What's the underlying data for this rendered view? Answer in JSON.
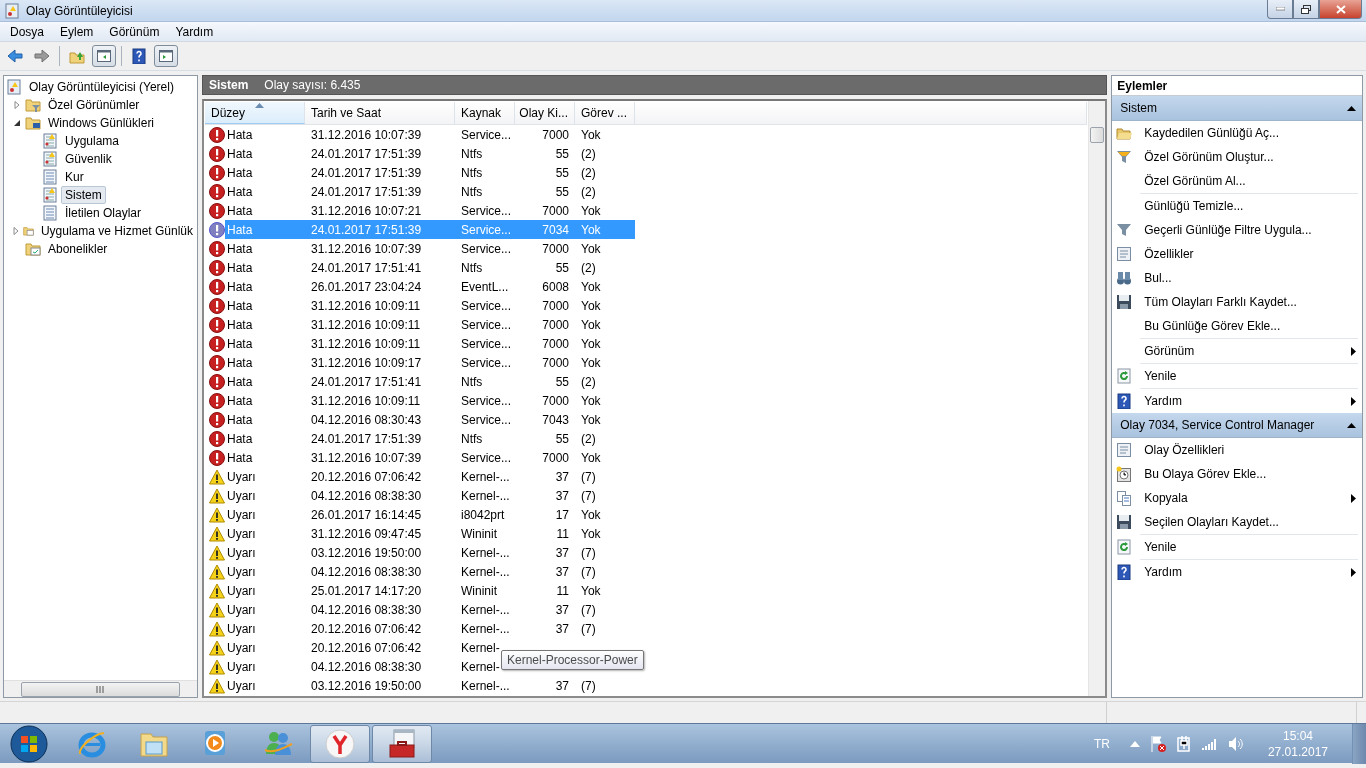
{
  "window": {
    "title": "Olay Görüntüleyicisi"
  },
  "menu": [
    "Dosya",
    "Eylem",
    "Görünüm",
    "Yardım"
  ],
  "toolbar": [
    {
      "kind": "back",
      "pressed": false
    },
    {
      "kind": "forward",
      "pressed": false
    },
    {
      "kind": "up",
      "pressed": false
    },
    {
      "kind": "tree-pane",
      "pressed": true
    },
    {
      "kind": "help",
      "pressed": false
    },
    {
      "kind": "action-pane",
      "pressed": true
    }
  ],
  "tree": [
    {
      "label": "Olay Görüntüleyicisi (Yerel)",
      "kind": "root",
      "selected": false
    },
    {
      "label": "Özel Görünümler",
      "kind": "filter-folder",
      "selected": false,
      "expanded": false
    },
    {
      "label": "Windows Günlükleri",
      "kind": "pc-folder",
      "selected": false,
      "expanded": true,
      "children": [
        {
          "label": "Uygulama",
          "kind": "log-alert",
          "selected": false
        },
        {
          "label": "Güvenlik",
          "kind": "log-alert",
          "selected": false
        },
        {
          "label": "Kur",
          "kind": "log",
          "selected": false
        },
        {
          "label": "Sistem",
          "kind": "log-alert",
          "selected": true
        },
        {
          "label": "İletilen Olaylar",
          "kind": "log",
          "selected": false
        }
      ]
    },
    {
      "label": "Uygulama ve Hizmet Günlük",
      "kind": "folder",
      "selected": false,
      "expanded": false
    },
    {
      "label": "Abonelikler",
      "kind": "sub-folder",
      "selected": false
    }
  ],
  "log_header": {
    "title": "Sistem",
    "count": "Olay sayısı: 6.435"
  },
  "table": {
    "columns": [
      {
        "label": "Düzey",
        "sorted": true
      },
      {
        "label": "Tarih ve Saat",
        "sorted": false
      },
      {
        "label": "Kaynak",
        "sorted": false
      },
      {
        "label": "Olay Ki...",
        "sorted": false
      },
      {
        "label": "Görev ...",
        "sorted": false
      }
    ],
    "rows": [
      {
        "kind": "error",
        "severity": "Hata",
        "date": "31.12.2016 10:07:39",
        "source": "Service...",
        "event_id": "7000",
        "task": "Yok",
        "selected": false
      },
      {
        "kind": "error",
        "severity": "Hata",
        "date": "24.01.2017 17:51:39",
        "source": "Ntfs",
        "event_id": "55",
        "task": "(2)",
        "selected": false
      },
      {
        "kind": "error",
        "severity": "Hata",
        "date": "24.01.2017 17:51:39",
        "source": "Ntfs",
        "event_id": "55",
        "task": "(2)",
        "selected": false
      },
      {
        "kind": "error",
        "severity": "Hata",
        "date": "24.01.2017 17:51:39",
        "source": "Ntfs",
        "event_id": "55",
        "task": "(2)",
        "selected": false
      },
      {
        "kind": "error",
        "severity": "Hata",
        "date": "31.12.2016 10:07:21",
        "source": "Service...",
        "event_id": "7000",
        "task": "Yok",
        "selected": false
      },
      {
        "kind": "error",
        "severity": "Hata",
        "date": "24.01.2017 17:51:39",
        "source": "Service...",
        "event_id": "7034",
        "task": "Yok",
        "selected": true
      },
      {
        "kind": "error",
        "severity": "Hata",
        "date": "31.12.2016 10:07:39",
        "source": "Service...",
        "event_id": "7000",
        "task": "Yok",
        "selected": false
      },
      {
        "kind": "error",
        "severity": "Hata",
        "date": "24.01.2017 17:51:41",
        "source": "Ntfs",
        "event_id": "55",
        "task": "(2)",
        "selected": false
      },
      {
        "kind": "error",
        "severity": "Hata",
        "date": "26.01.2017 23:04:24",
        "source": "EventL...",
        "event_id": "6008",
        "task": "Yok",
        "selected": false
      },
      {
        "kind": "error",
        "severity": "Hata",
        "date": "31.12.2016 10:09:11",
        "source": "Service...",
        "event_id": "7000",
        "task": "Yok",
        "selected": false
      },
      {
        "kind": "error",
        "severity": "Hata",
        "date": "31.12.2016 10:09:11",
        "source": "Service...",
        "event_id": "7000",
        "task": "Yok",
        "selected": false
      },
      {
        "kind": "error",
        "severity": "Hata",
        "date": "31.12.2016 10:09:11",
        "source": "Service...",
        "event_id": "7000",
        "task": "Yok",
        "selected": false
      },
      {
        "kind": "error",
        "severity": "Hata",
        "date": "31.12.2016 10:09:17",
        "source": "Service...",
        "event_id": "7000",
        "task": "Yok",
        "selected": false
      },
      {
        "kind": "error",
        "severity": "Hata",
        "date": "24.01.2017 17:51:41",
        "source": "Ntfs",
        "event_id": "55",
        "task": "(2)",
        "selected": false
      },
      {
        "kind": "error",
        "severity": "Hata",
        "date": "31.12.2016 10:09:11",
        "source": "Service...",
        "event_id": "7000",
        "task": "Yok",
        "selected": false
      },
      {
        "kind": "error",
        "severity": "Hata",
        "date": "04.12.2016 08:30:43",
        "source": "Service...",
        "event_id": "7043",
        "task": "Yok",
        "selected": false
      },
      {
        "kind": "error",
        "severity": "Hata",
        "date": "24.01.2017 17:51:39",
        "source": "Ntfs",
        "event_id": "55",
        "task": "(2)",
        "selected": false
      },
      {
        "kind": "error",
        "severity": "Hata",
        "date": "31.12.2016 10:07:39",
        "source": "Service...",
        "event_id": "7000",
        "task": "Yok",
        "selected": false
      },
      {
        "kind": "warning",
        "severity": "Uyarı",
        "date": "20.12.2016 07:06:42",
        "source": "Kernel-...",
        "event_id": "37",
        "task": "(7)",
        "selected": false
      },
      {
        "kind": "warning",
        "severity": "Uyarı",
        "date": "04.12.2016 08:38:30",
        "source": "Kernel-...",
        "event_id": "37",
        "task": "(7)",
        "selected": false
      },
      {
        "kind": "warning",
        "severity": "Uyarı",
        "date": "26.01.2017 16:14:45",
        "source": "i8042prt",
        "event_id": "17",
        "task": "Yok",
        "selected": false
      },
      {
        "kind": "warning",
        "severity": "Uyarı",
        "date": "31.12.2016 09:47:45",
        "source": "Wininit",
        "event_id": "11",
        "task": "Yok",
        "selected": false
      },
      {
        "kind": "warning",
        "severity": "Uyarı",
        "date": "03.12.2016 19:50:00",
        "source": "Kernel-...",
        "event_id": "37",
        "task": "(7)",
        "selected": false
      },
      {
        "kind": "warning",
        "severity": "Uyarı",
        "date": "04.12.2016 08:38:30",
        "source": "Kernel-...",
        "event_id": "37",
        "task": "(7)",
        "selected": false
      },
      {
        "kind": "warning",
        "severity": "Uyarı",
        "date": "25.01.2017 14:17:20",
        "source": "Wininit",
        "event_id": "11",
        "task": "Yok",
        "selected": false
      },
      {
        "kind": "warning",
        "severity": "Uyarı",
        "date": "04.12.2016 08:38:30",
        "source": "Kernel-...",
        "event_id": "37",
        "task": "(7)",
        "selected": false
      },
      {
        "kind": "warning",
        "severity": "Uyarı",
        "date": "20.12.2016 07:06:42",
        "source": "Kernel-...",
        "event_id": "37",
        "task": "(7)",
        "selected": false
      },
      {
        "kind": "warning",
        "severity": "Uyarı",
        "date": "20.12.2016 07:06:42",
        "source": "Kernel-",
        "selected": false
      },
      {
        "kind": "warning",
        "severity": "Uyarı",
        "date": "04.12.2016 08:38:30",
        "source": "Kernel-",
        "selected": false
      },
      {
        "kind": "warning",
        "severity": "Uyarı",
        "date": "03.12.2016 19:50:00",
        "source": "Kernel-...",
        "event_id": "37",
        "task": "(7)",
        "selected": false
      }
    ]
  },
  "tooltip": "Kernel-Processor-Power",
  "actions": {
    "title": "Eylemler",
    "sections": [
      {
        "title": "Sistem",
        "expanded": true,
        "groups": [
          [
            {
              "label": "Kaydedilen Günlüğü Aç...",
              "kind": "open",
              "submenu": false
            },
            {
              "label": "Özel Görünüm Oluştur...",
              "kind": "filter-new",
              "submenu": false
            },
            {
              "label": "Özel Görünüm Al...",
              "kind": "none",
              "submenu": false
            }
          ],
          [
            {
              "label": "Günlüğü Temizle...",
              "kind": "none",
              "submenu": false
            },
            {
              "label": "Geçerli Günlüğe Filtre Uygula...",
              "kind": "filter",
              "submenu": false
            },
            {
              "label": "Özellikler",
              "kind": "properties",
              "submenu": false
            },
            {
              "label": "Bul...",
              "kind": "find",
              "submenu": false
            },
            {
              "label": "Tüm Olayları Farklı Kaydet...",
              "kind": "save",
              "submenu": false
            },
            {
              "label": "Bu Günlüğe Görev Ekle...",
              "kind": "none",
              "submenu": false
            }
          ],
          [
            {
              "label": "Görünüm",
              "kind": "none",
              "submenu": true
            }
          ],
          [
            {
              "label": "Yenile",
              "kind": "refresh",
              "submenu": false
            }
          ],
          [
            {
              "label": "Yardım",
              "kind": "help",
              "submenu": true
            }
          ]
        ]
      },
      {
        "title": "Olay 7034, Service Control Manager",
        "expanded": true,
        "groups": [
          [
            {
              "label": "Olay Özellikleri",
              "kind": "properties",
              "submenu": false
            },
            {
              "label": "Bu Olaya Görev Ekle...",
              "kind": "task",
              "submenu": false
            },
            {
              "label": "Kopyala",
              "kind": "copy",
              "submenu": true
            },
            {
              "label": "Seçilen Olayları Kaydet...",
              "kind": "save",
              "submenu": false
            }
          ],
          [
            {
              "label": "Yenile",
              "kind": "refresh",
              "submenu": false
            }
          ],
          [
            {
              "label": "Yardım",
              "kind": "help",
              "submenu": true
            }
          ]
        ]
      }
    ]
  },
  "taskbar": {
    "apps": [
      {
        "kind": "ie",
        "open": false
      },
      {
        "kind": "explorer",
        "open": false
      },
      {
        "kind": "media",
        "open": false
      },
      {
        "kind": "messenger",
        "open": false
      },
      {
        "kind": "yandex",
        "open": true
      },
      {
        "kind": "toolbox",
        "open": true
      }
    ],
    "language": "TR",
    "time": "15:04",
    "date": "27.01.2017"
  }
}
